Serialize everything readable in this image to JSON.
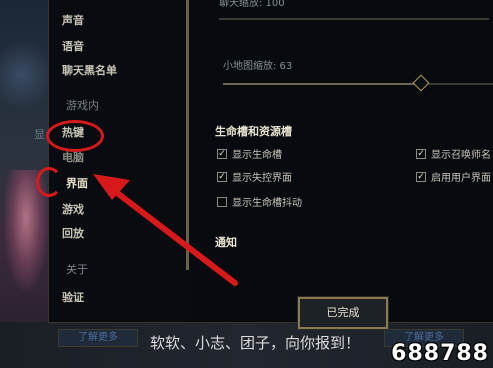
{
  "nav": {
    "items_top": [
      "声音",
      "语音",
      "聊天黑名单"
    ],
    "section_ingame": "游戏内",
    "item_hotkeys": "热键",
    "item_partial": "电脑",
    "item_interface": "界面",
    "item_game": "游戏",
    "item_replay": "回放",
    "section_about": "关于",
    "item_verify": "验证"
  },
  "settings": {
    "top_slider_label": "聊天缩放: 100",
    "minimap_label": "小地图缩放: 63",
    "minimap_value": 63,
    "section_health": "生命槽和资源槽",
    "opt_show_health": "显示生命槽",
    "opt_show_loss_control": "显示失控界面",
    "opt_health_shake": "显示生命槽抖动",
    "opt_show_summoner": "显示召唤师名",
    "opt_enable_user_ui": "启用用户界面",
    "section_notify": "通知"
  },
  "footer": {
    "done_label": "已完成"
  },
  "background": {
    "side_text": "显",
    "chip_left": "了解更多",
    "chip_right": "了解更多",
    "banner": "软软、小志、团子，向你报到！"
  },
  "watermark": "688788",
  "colors": {
    "annotation": "#d8191b",
    "accent_gold": "#b59a5a"
  }
}
